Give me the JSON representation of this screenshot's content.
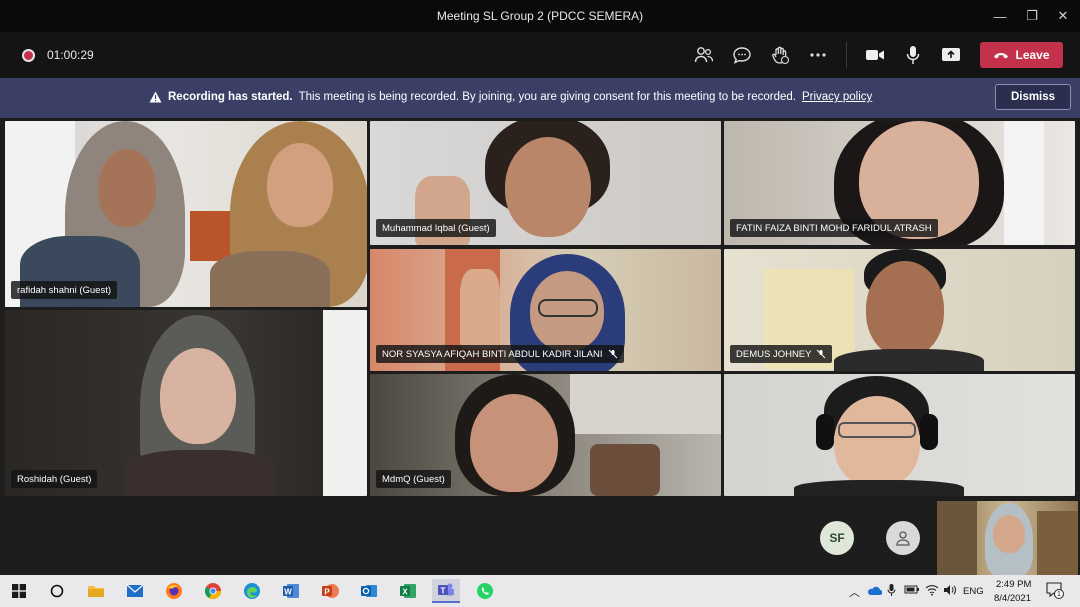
{
  "window": {
    "title": "Meeting SL Group 2 (PDCC SEMERA)",
    "minimize_glyph": "—",
    "maximize_glyph": "❐",
    "close_glyph": "✕"
  },
  "toolbar": {
    "recording_time": "01:00:29",
    "icons": [
      "participants-icon",
      "chat-icon",
      "raise-hand-icon",
      "more-options-icon",
      "camera-icon",
      "microphone-icon",
      "share-screen-icon"
    ],
    "leave_label": "Leave"
  },
  "banner": {
    "title": "Recording has started.",
    "message": "This meeting is being recorded. By joining, you are giving consent for this meeting to be recorded.",
    "link": "Privacy policy",
    "dismiss_label": "Dismiss"
  },
  "participants": [
    {
      "name": "rafidah shahni (Guest)",
      "muted": false
    },
    {
      "name": "Muhammad Iqbal (Guest)",
      "muted": false
    },
    {
      "name": "FATIN FAIZA BINTI MOHD FARIDUL ATRASH",
      "muted": false
    },
    {
      "name": "NOR SYASYA AFIQAH BINTI ABDUL KADIR JILANI",
      "muted": true
    },
    {
      "name": "DEMUS JOHNEY",
      "muted": true
    },
    {
      "name": "Roshidah (Guest)",
      "muted": false
    },
    {
      "name": "MdmQ (Guest)",
      "muted": false
    },
    {
      "name": "",
      "muted": false
    }
  ],
  "overflow": {
    "initials": "SF"
  },
  "taskbar": {
    "apps": [
      "windows-start-icon",
      "cortana-icon",
      "file-explorer-icon",
      "mail-icon",
      "firefox-icon",
      "chrome-icon",
      "edge-icon",
      "word-icon",
      "powerpoint-icon",
      "outlook-icon",
      "excel-icon",
      "teams-icon",
      "whatsapp-icon"
    ],
    "language": "ENG",
    "time": "2:49 PM",
    "date": "8/4/2021",
    "notification_count": "1"
  },
  "colors": {
    "leave": "#c4314b",
    "banner": "#3b3f66",
    "titlebar": "#0a0a0a"
  }
}
